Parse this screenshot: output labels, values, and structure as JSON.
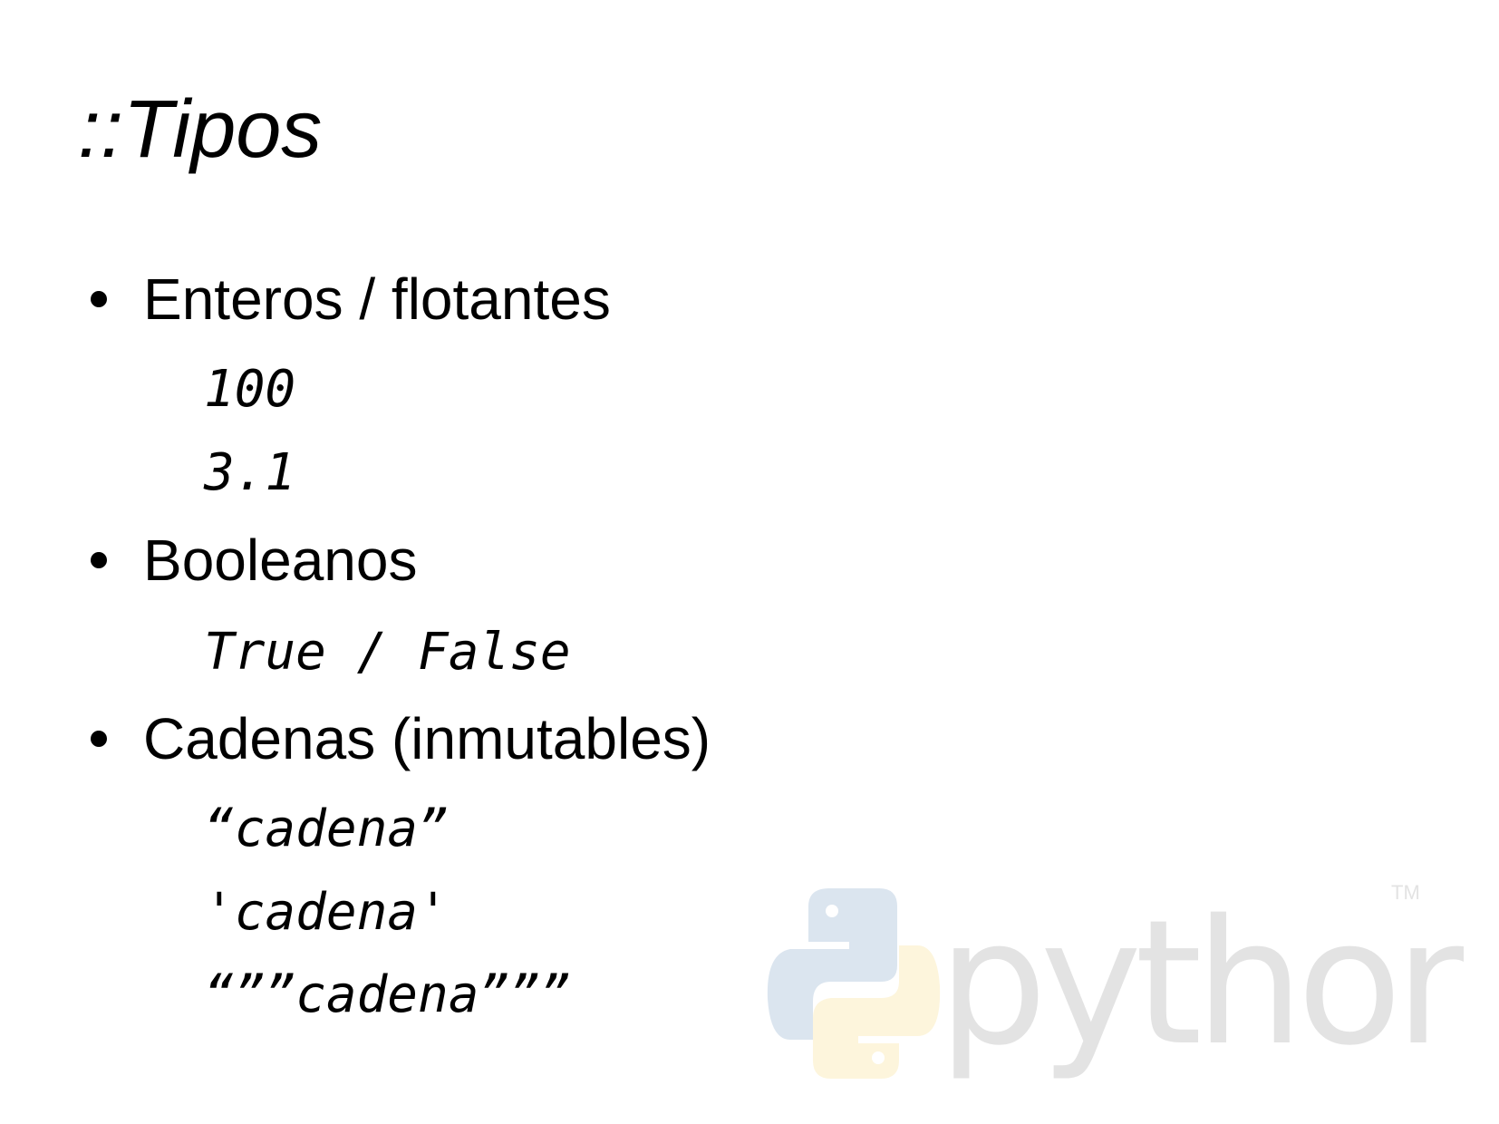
{
  "slide": {
    "title": "::Tipos",
    "bullets": [
      {
        "label": "Enteros / flotantes",
        "examples": [
          "100",
          "3.1"
        ]
      },
      {
        "label": "Booleanos",
        "examples": [
          "True / False"
        ]
      },
      {
        "label": "Cadenas (inmutables)",
        "examples": [
          "“cadena”",
          "'cadena'",
          "“””cadena”””"
        ]
      }
    ],
    "logo": {
      "text": "python",
      "trademark": "TM",
      "colors": {
        "blue": "#dbe5ef",
        "yellow": "#fdf5dc",
        "text": "#e3e3e3"
      }
    }
  }
}
